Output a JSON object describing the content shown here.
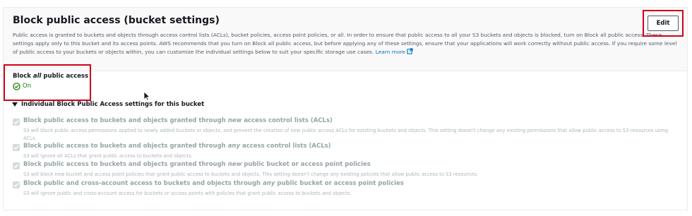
{
  "header": {
    "title": "Block public access (bucket settings)",
    "description": "Public access is granted to buckets and objects through access control lists (ACLs), bucket policies, access point policies, or all. In order to ensure that public access to all your S3 buckets and objects is blocked, turn on Block all public access. These settings apply only to this bucket and its access points. AWS recommends that you turn on Block all public access, but before applying any of these settings, ensure that your applications will work correctly without public access. If you require some level of public access to your buckets or objects within, you can customize the individual settings below to suit your specific storage use cases.",
    "learn_more": "Learn more",
    "edit_label": "Edit"
  },
  "block_all": {
    "title_pre": "Block ",
    "title_em": "all",
    "title_post": " public access",
    "status": "On",
    "status_color": "#1d8102"
  },
  "individual": {
    "heading": "Individual Block Public Access settings for this bucket",
    "settings": [
      {
        "title_pre": "Block public access to buckets and objects granted through ",
        "title_em": "new",
        "title_post": " access control lists (ACLs)",
        "desc": "S3 will block public access permissions applied to newly added buckets or objects, and prevent the creation of new public access ACLs for existing buckets and objects. This setting doesn't change any existing permissions that allow public access to S3 resources using ACLs."
      },
      {
        "title_pre": "Block public access to buckets and objects granted through ",
        "title_em": "any",
        "title_post": " access control lists (ACLs)",
        "desc": "S3 will ignore all ACLs that grant public access to buckets and objects."
      },
      {
        "title_pre": "Block public access to buckets and objects granted through ",
        "title_em": "new",
        "title_post": " public bucket or access point policies",
        "desc": "S3 will block new bucket and access point policies that grant public access to buckets and objects. This setting doesn't change any existing policies that allow public access to S3 resources."
      },
      {
        "title_pre": "Block public and cross-account access to buckets and objects through ",
        "title_em": "any",
        "title_post": " public bucket or access point policies",
        "desc": "S3 will ignore public and cross-account access for buckets or access points with policies that grant public access to buckets and objects."
      }
    ]
  },
  "icons": {
    "external_link": "external-link-icon",
    "status": "check-circle-icon",
    "checkbox": "checkmark-icon",
    "expand": "caret-down-icon",
    "cursor": "mouse-pointer-icon"
  },
  "colors": {
    "highlight": "#d0021b",
    "link": "#0073bb",
    "disabled_text": "#95a5a6"
  }
}
